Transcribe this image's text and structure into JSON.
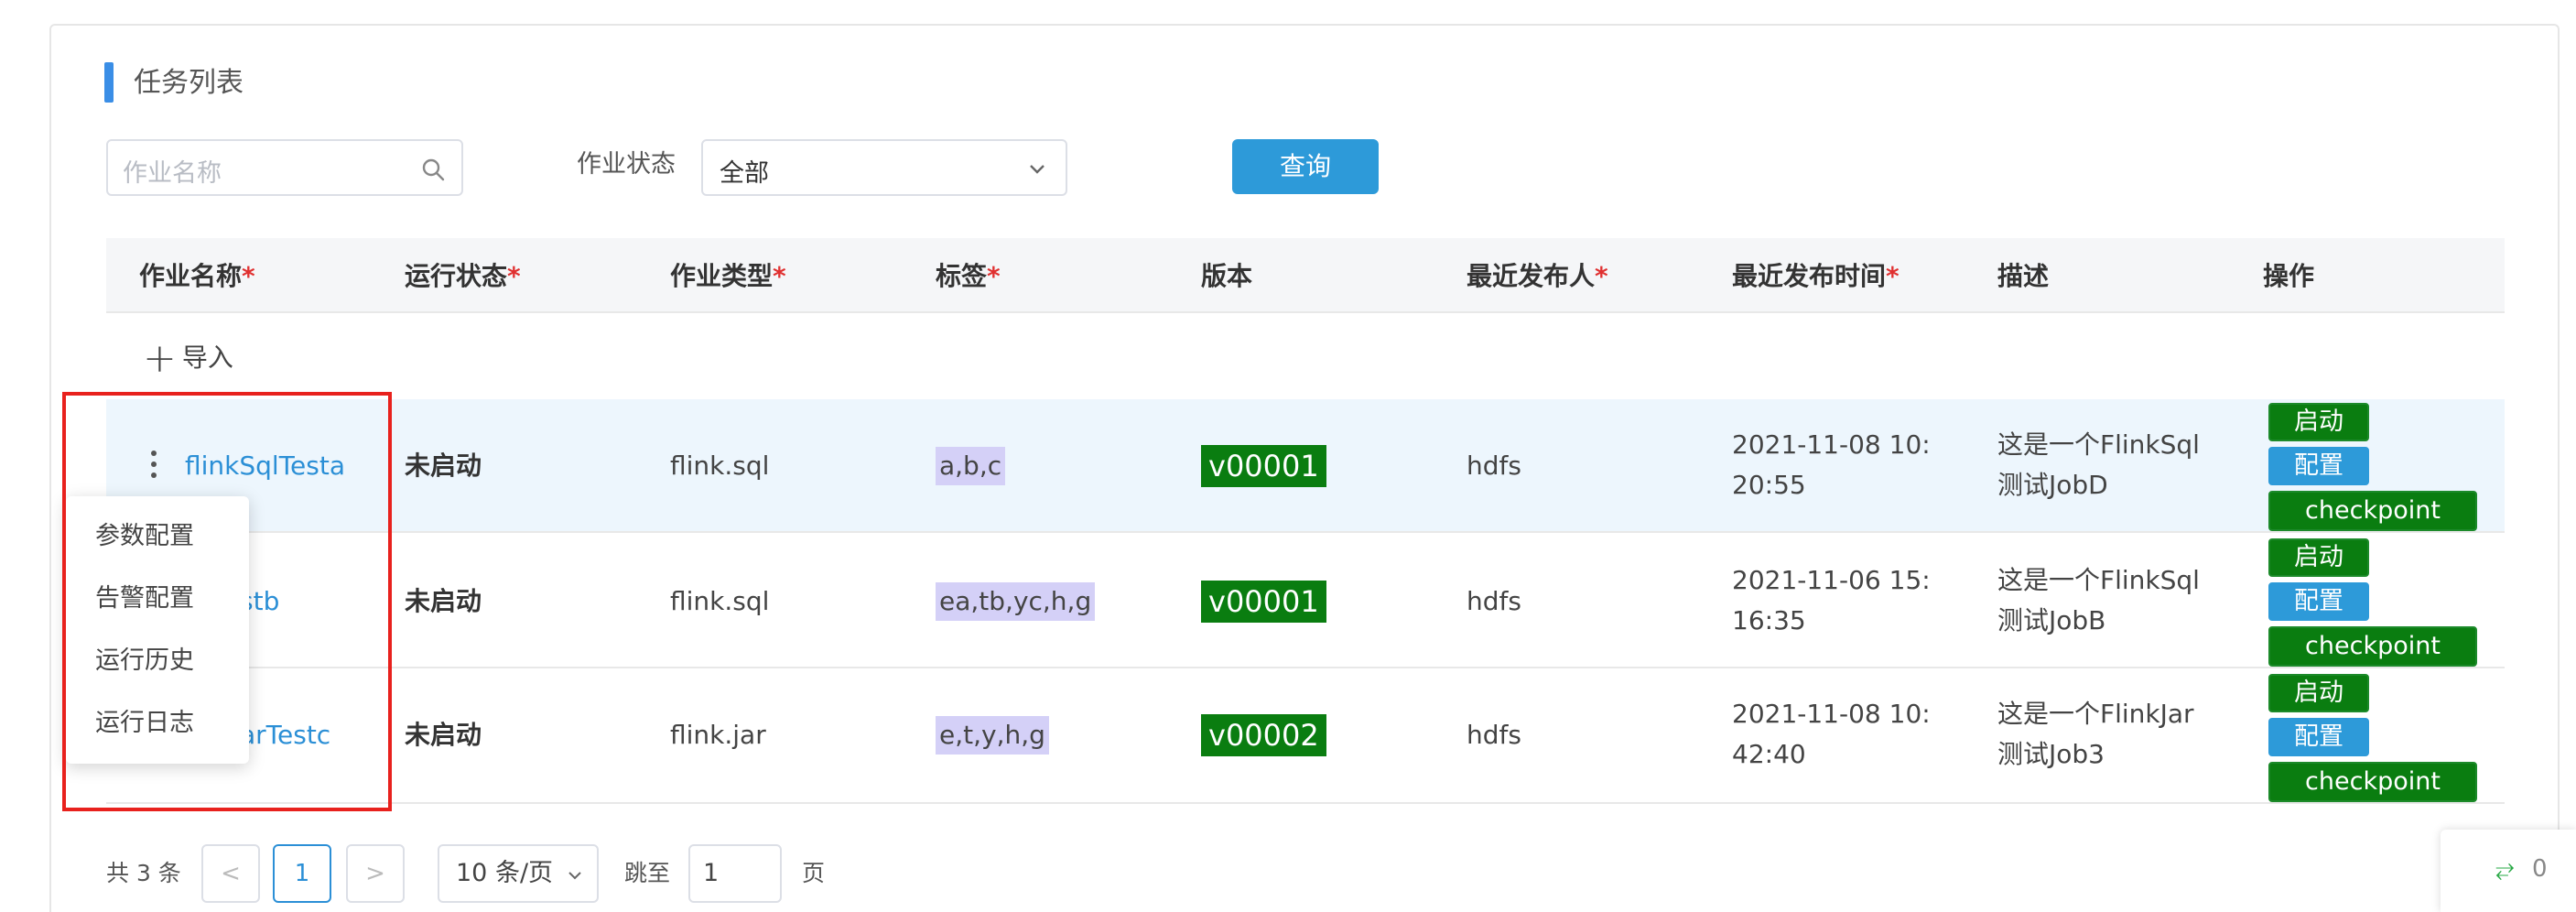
{
  "panel": {
    "title": "任务列表"
  },
  "filters": {
    "search_placeholder": "作业名称",
    "status_label": "作业状态",
    "status_value": "全部",
    "query_label": "查询"
  },
  "columns": [
    {
      "label": "作业名称",
      "required": "*"
    },
    {
      "label": "运行状态",
      "required": "*"
    },
    {
      "label": "作业类型",
      "required": "*"
    },
    {
      "label": "标签",
      "required": "*"
    },
    {
      "label": "版本",
      "required": ""
    },
    {
      "label": "最近发布人",
      "required": "*"
    },
    {
      "label": "最近发布时间",
      "required": "*"
    },
    {
      "label": "描述",
      "required": ""
    },
    {
      "label": "操作",
      "required": ""
    }
  ],
  "import_label": "导入",
  "rows": [
    {
      "name": "flinkSqlTesta",
      "status": "未启动",
      "type": "flink.sql",
      "tags": "a,b,c",
      "version": "v00001",
      "publisher": "hdfs",
      "time_line1": "2021-11-08 10:",
      "time_line2": "20:55",
      "desc_line1": "这是一个FlinkSql",
      "desc_line2": "测试JobD"
    },
    {
      "name": "stb",
      "status": "未启动",
      "type": "flink.sql",
      "tags": "ea,tb,yc,h,g",
      "version": "v00001",
      "publisher": "hdfs",
      "time_line1": "2021-11-06 15:",
      "time_line2": "16:35",
      "desc_line1": "这是一个FlinkSql",
      "desc_line2": "测试JobB"
    },
    {
      "name": "arTestc",
      "status": "未启动",
      "type": "flink.jar",
      "tags": "e,t,y,h,g",
      "version": "v00002",
      "publisher": "hdfs",
      "time_line1": "2021-11-08 10:",
      "time_line2": "42:40",
      "desc_line1": "这是一个FlinkJar",
      "desc_line2": "测试Job3"
    }
  ],
  "actions": {
    "start": "启动",
    "config": "配置",
    "checkpoint": "checkpoint"
  },
  "context_menu": [
    "参数配置",
    "告警配置",
    "运行历史",
    "运行日志"
  ],
  "pagination": {
    "total": "共 3 条",
    "prev": "<",
    "current_page": "1",
    "next": ">",
    "page_size": "10 条/页",
    "goto_label": "跳至",
    "goto_value": "1",
    "page_suffix": "页"
  },
  "corner": {
    "count": "0"
  },
  "colors": {
    "accent": "#2d9ad9",
    "version_bg": "#0a7d10",
    "tag_bg": "#d4d0f7",
    "highlight": "#e8211d"
  }
}
